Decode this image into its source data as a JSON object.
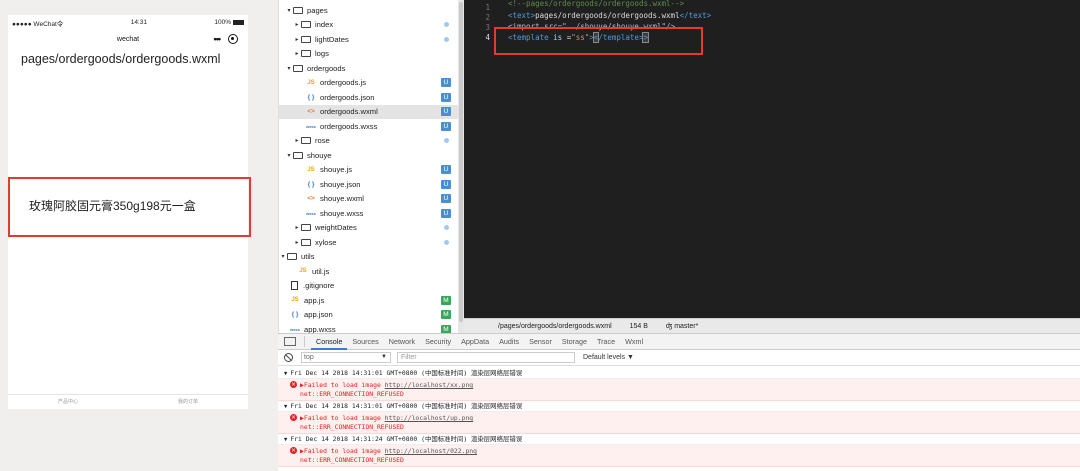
{
  "simulator": {
    "status_left": "●●●●● WeChat令",
    "status_time": "14:31",
    "status_battery": "100%",
    "nav_title": "wechat",
    "nav_dots": "•••",
    "path_text": "pages/ordergoods/ordergoods.wxml",
    "product_text": "玫瑰阿胶固元膏350g198元一盒",
    "tabbar": [
      "产品中心",
      "我的订单"
    ]
  },
  "tree": {
    "items": [
      {
        "label": "pages",
        "type": "folder",
        "open": true
      },
      {
        "label": "index",
        "type": "folder",
        "status": "dot"
      },
      {
        "label": "lightDates",
        "type": "folder",
        "status": "dot"
      },
      {
        "label": "logs",
        "type": "folder"
      },
      {
        "label": "ordergoods",
        "type": "folder",
        "open": true
      },
      {
        "label": "ordergoods.js",
        "type": "js",
        "status": "U"
      },
      {
        "label": "ordergoods.json",
        "type": "json",
        "status": "U"
      },
      {
        "label": "ordergoods.wxml",
        "type": "wxml",
        "status": "U"
      },
      {
        "label": "ordergoods.wxss",
        "type": "wxss",
        "status": "U"
      },
      {
        "label": "rose",
        "type": "folder",
        "status": "dot"
      },
      {
        "label": "shouye",
        "type": "folder",
        "open": true
      },
      {
        "label": "shouye.js",
        "type": "js",
        "status": "U"
      },
      {
        "label": "shouye.json",
        "type": "json",
        "status": "U"
      },
      {
        "label": "shouye.wxml",
        "type": "wxml",
        "status": "U"
      },
      {
        "label": "shouye.wxss",
        "type": "wxss",
        "status": "U"
      },
      {
        "label": "weightDates",
        "type": "folder",
        "status": "dot"
      },
      {
        "label": "xylose",
        "type": "folder",
        "status": "dot"
      },
      {
        "label": "utils",
        "type": "folder",
        "open": true
      },
      {
        "label": "util.js",
        "type": "js"
      },
      {
        "label": ".gitignore",
        "type": "file"
      },
      {
        "label": "app.js",
        "type": "js",
        "status": "M"
      },
      {
        "label": "app.json",
        "type": "json",
        "status": "M"
      },
      {
        "label": "app.wxss",
        "type": "wxss",
        "status": "M"
      }
    ],
    "icons": {
      "js": "JS",
      "json": "{ }",
      "wxml": "<>",
      "wxss": "wxss"
    }
  },
  "editor": {
    "line_numbers": [
      "1",
      "2",
      "3",
      "4"
    ],
    "line1": "<!--pages/ordergoods/ordergoods.wxml-->",
    "line2_open": "<text>",
    "line2_text": "pages/ordergoods/ordergoods.wxml",
    "line2_close": "</text>",
    "line3": "<import src=\"../shouye/shouye.wxml\"/>",
    "line4_open": "<template",
    "line4_attr": " is ",
    "line4_eq": "=",
    "line4_val": "\"ss\"",
    "line4_gt": ">",
    "line4_close_lt": "<",
    "line4_close": "/template>"
  },
  "statusbar": {
    "path": "/pages/ordergoods/ordergoods.wxml",
    "size": "154 B",
    "branch": "ʤ master*"
  },
  "devtools": {
    "tabs": [
      "Console",
      "Sources",
      "Network",
      "Security",
      "AppData",
      "Audits",
      "Sensor",
      "Storage",
      "Trace",
      "Wxml"
    ],
    "context": "top",
    "context_arrow": "▼",
    "filter_placeholder": "Filter",
    "levels": "Default levels ▼",
    "messages": [
      {
        "group": "Fri Dec 14 2018 14:31:01 GMT+0800 (中国标准时间) 渲染层网络层错误",
        "err1": "▶Failed to load image ",
        "link": "http://localhost/xx.png",
        "err2": "net::ERR_CONNECTION_REFUSED"
      },
      {
        "group": "Fri Dec 14 2018 14:31:01 GMT+0800 (中国标准时间) 渲染层网络层错误",
        "err1": "▶Failed to load image ",
        "link": "http://localhost/up.png",
        "err2": "net::ERR_CONNECTION_REFUSED"
      },
      {
        "group": "Fri Dec 14 2018 14:31:24 GMT+0800 (中国标准时间) 渲染层网络层错误",
        "err1": "▶Failed to load image ",
        "link": "http://localhost/022.png",
        "err2": "net::ERR_CONNECTION_REFUSED"
      }
    ]
  },
  "colors": {
    "highlight_box": "#e33b2e",
    "editor_bg": "#1f1f1f",
    "error_bg": "#fff0f0",
    "badge_u": "#4a8fd4",
    "badge_m": "#3ba55c"
  }
}
